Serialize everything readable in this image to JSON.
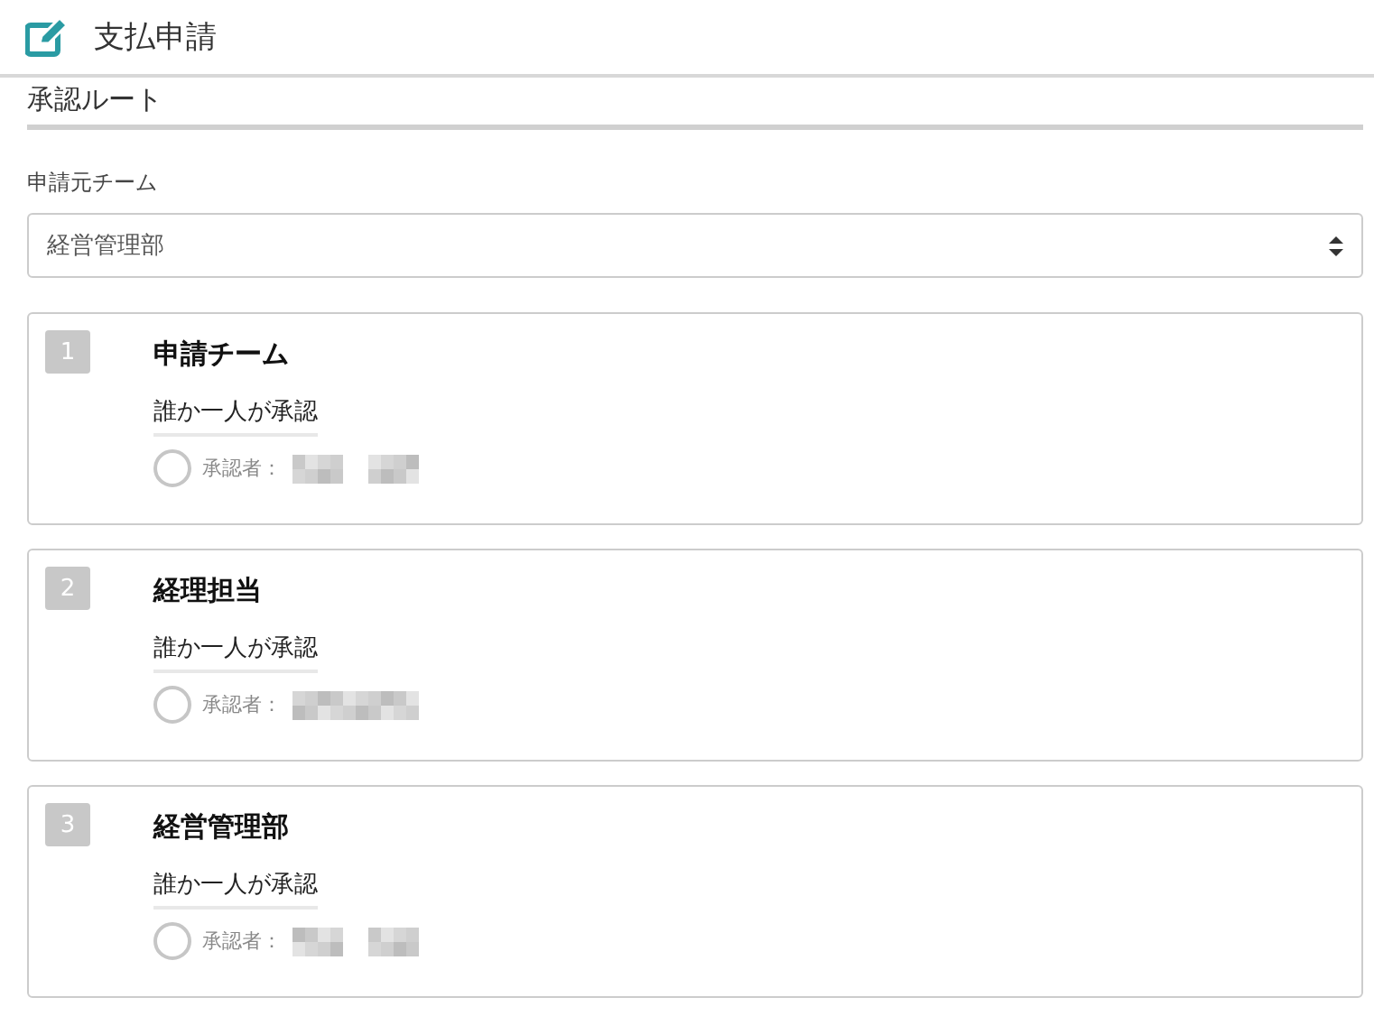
{
  "header": {
    "title": "支払申請"
  },
  "section": {
    "title": "承認ルート"
  },
  "team_select": {
    "label": "申請元チーム",
    "value": "経営管理部"
  },
  "steps": [
    {
      "number": "1",
      "title": "申請チーム",
      "rule": "誰か一人が承認",
      "approver_label": "承認者：",
      "checked": false
    },
    {
      "number": "2",
      "title": "経理担当",
      "rule": "誰か一人が承認",
      "approver_label": "承認者：",
      "checked": false
    },
    {
      "number": "3",
      "title": "経営管理部",
      "rule": "誰か一人が承認",
      "approver_label": "承認者：",
      "checked": false
    }
  ]
}
